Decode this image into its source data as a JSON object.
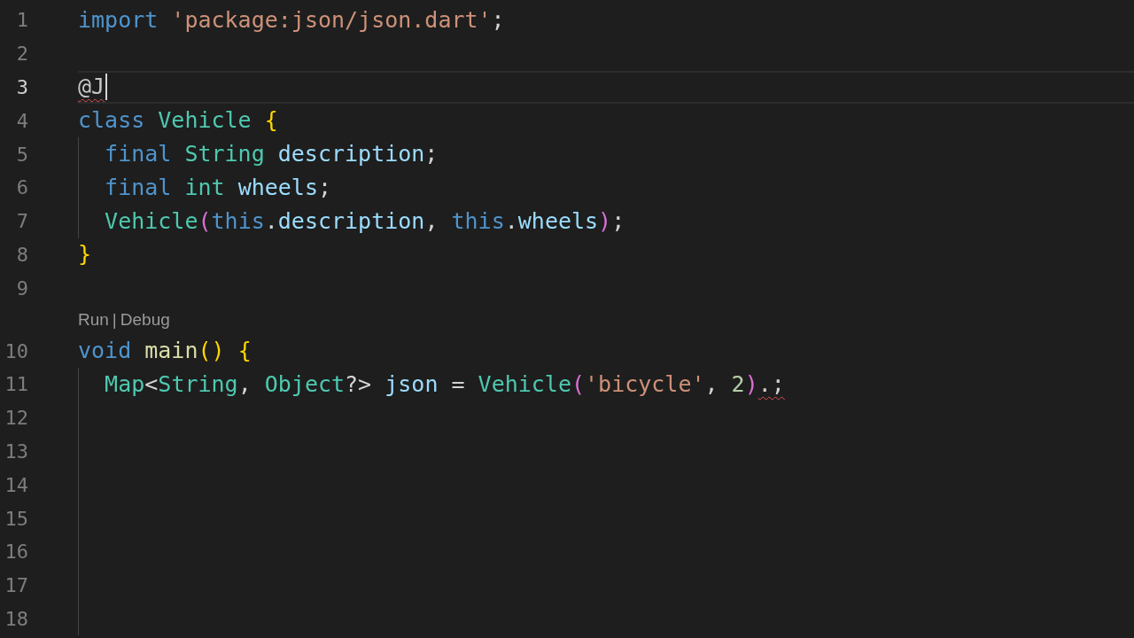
{
  "editor": {
    "lines": [
      {
        "number": "1",
        "current": false,
        "guide": false,
        "tokens": [
          {
            "text": "import",
            "kind": "keyword"
          },
          {
            "text": " 'package:json/json.dart'",
            "kind": "string"
          },
          {
            "text": ";",
            "kind": "plain"
          }
        ]
      },
      {
        "number": "2",
        "current": false,
        "guide": false
      },
      {
        "number": "3",
        "current": true,
        "guide": false,
        "cursor": true,
        "tokens": [
          {
            "text": "@J",
            "kind": "annotation",
            "error": true
          }
        ]
      },
      {
        "number": "4",
        "current": false,
        "guide": false,
        "tokens": [
          {
            "text": "class",
            "kind": "keyword"
          },
          {
            "text": " Vehicle",
            "kind": "type"
          },
          {
            "text": " {",
            "kind": "bracket1"
          }
        ]
      },
      {
        "number": "5",
        "current": false,
        "guide": true,
        "tokens": [
          {
            "text": "  final",
            "kind": "keyword"
          },
          {
            "text": " String",
            "kind": "type"
          },
          {
            "text": " description",
            "kind": "variable"
          },
          {
            "text": ";",
            "kind": "plain"
          }
        ]
      },
      {
        "number": "6",
        "current": false,
        "guide": true,
        "tokens": [
          {
            "text": "  final",
            "kind": "keyword"
          },
          {
            "text": " int",
            "kind": "type"
          },
          {
            "text": " wheels",
            "kind": "variable"
          },
          {
            "text": ";",
            "kind": "plain"
          }
        ]
      },
      {
        "number": "7",
        "current": false,
        "guide": true,
        "tokens": [
          {
            "text": "  Vehicle",
            "kind": "type"
          },
          {
            "text": "(",
            "kind": "bracket2"
          },
          {
            "text": "this",
            "kind": "keyword"
          },
          {
            "text": ".",
            "kind": "plain"
          },
          {
            "text": "description",
            "kind": "variable"
          },
          {
            "text": ", ",
            "kind": "plain"
          },
          {
            "text": "this",
            "kind": "keyword"
          },
          {
            "text": ".",
            "kind": "plain"
          },
          {
            "text": "wheels",
            "kind": "variable"
          },
          {
            "text": ")",
            "kind": "bracket2"
          },
          {
            "text": ";",
            "kind": "plain"
          }
        ]
      },
      {
        "number": "8",
        "current": false,
        "guide": false,
        "tokens": [
          {
            "text": "}",
            "kind": "bracket1"
          }
        ]
      },
      {
        "number": "9",
        "current": false,
        "guide": false
      },
      {
        "number": "10",
        "current": false,
        "guide": false,
        "codelens": {
          "items": [
            "Run",
            "Debug"
          ],
          "separator": "|"
        },
        "tokens": [
          {
            "text": "void",
            "kind": "keyword"
          },
          {
            "text": " main",
            "kind": "function"
          },
          {
            "text": "()",
            "kind": "bracket1"
          },
          {
            "text": " {",
            "kind": "bracket1"
          }
        ]
      },
      {
        "number": "11",
        "current": false,
        "guide": true,
        "tokens": [
          {
            "text": "  Map",
            "kind": "type"
          },
          {
            "text": "<",
            "kind": "plain"
          },
          {
            "text": "String",
            "kind": "type"
          },
          {
            "text": ", ",
            "kind": "plain"
          },
          {
            "text": "Object",
            "kind": "type"
          },
          {
            "text": "?>",
            "kind": "plain"
          },
          {
            "text": " json",
            "kind": "variable"
          },
          {
            "text": " =",
            "kind": "plain"
          },
          {
            "text": " Vehicle",
            "kind": "type"
          },
          {
            "text": "(",
            "kind": "bracket2"
          },
          {
            "text": "'bicycle'",
            "kind": "string"
          },
          {
            "text": ", ",
            "kind": "plain"
          },
          {
            "text": "2",
            "kind": "number"
          },
          {
            "text": ")",
            "kind": "bracket2"
          },
          {
            "text": ".;",
            "kind": "plain",
            "error": true
          }
        ]
      },
      {
        "number": "12",
        "current": false,
        "guide": true
      },
      {
        "number": "13",
        "current": false,
        "guide": true
      },
      {
        "number": "14",
        "current": false,
        "guide": true
      },
      {
        "number": "15",
        "current": false,
        "guide": true
      },
      {
        "number": "16",
        "current": false,
        "guide": true
      },
      {
        "number": "17",
        "current": false,
        "guide": true
      },
      {
        "number": "18",
        "current": false,
        "guide": true
      }
    ]
  }
}
